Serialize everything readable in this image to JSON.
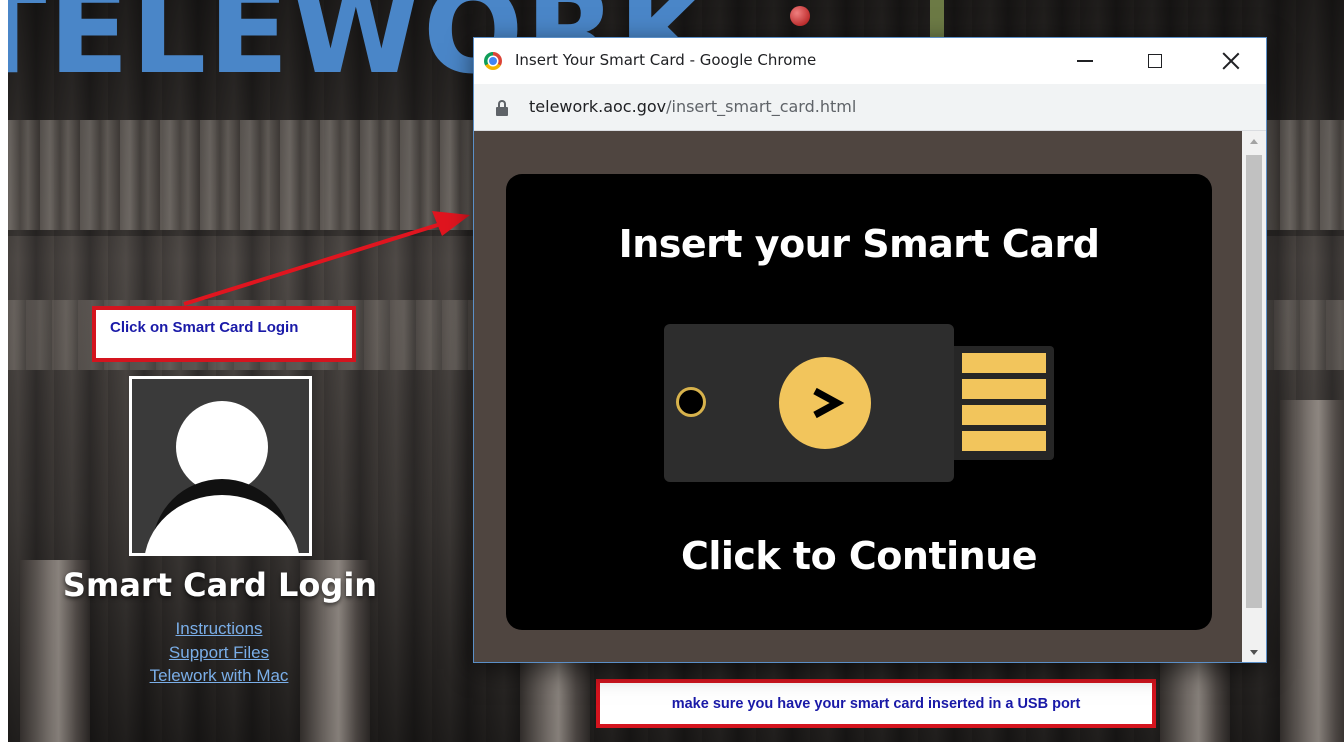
{
  "background_page": {
    "site_title": "TELEWORK",
    "login": {
      "title": "Smart Card Login",
      "links": [
        "Instructions",
        "Support Files",
        "Telework with Mac"
      ],
      "avatar_icon": "user-silhouette-icon"
    }
  },
  "annotations": {
    "left_callout": "Click on Smart Card Login",
    "bottom_callout": "make sure you have your smart card inserted in a USB port",
    "arrow_color": "#e0151f",
    "border_color": "#d4141e",
    "text_color": "#1a1aa8"
  },
  "popup_window": {
    "title": "Insert Your Smart Card - Google Chrome",
    "browser_icon": "chrome-logo-icon",
    "controls": {
      "minimize_icon": "minimize-icon",
      "maximize_icon": "maximize-icon",
      "close_icon": "close-icon"
    },
    "address_bar": {
      "lock_icon": "lock-icon",
      "url_host": "telework.aoc.gov",
      "url_path": "/insert_smart_card.html"
    },
    "content": {
      "heading": "Insert your Smart Card",
      "cta": "Click to Continue",
      "illustration_icon": "usb-security-key-icon",
      "accent_color": "#f2c55c",
      "page_bg": "#4f4540"
    }
  }
}
